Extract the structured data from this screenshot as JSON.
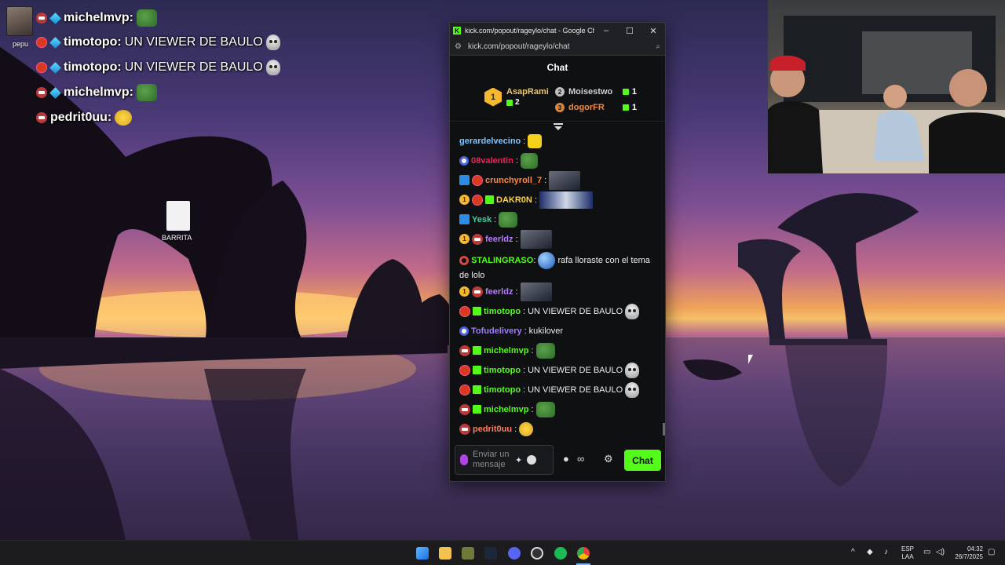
{
  "overlay": {
    "streamer_name": "pepu",
    "messages": [
      {
        "user": "michelmvp:",
        "text": ""
      },
      {
        "user": "timotopo:",
        "text": "UN VIEWER DE BAULO"
      },
      {
        "user": "timotopo:",
        "text": "UN VIEWER DE BAULO"
      },
      {
        "user": "michelmvp:",
        "text": ""
      },
      {
        "user": "pedrit0uu:",
        "text": ""
      }
    ]
  },
  "desktop": {
    "file_label": "BARRITA"
  },
  "browser": {
    "title": "kick.com/popout/rageylo/chat - Google Chro...",
    "url": "kick.com/popout/rageylo/chat",
    "minimize": "–",
    "maximize": "☐",
    "close": "✕"
  },
  "chat": {
    "header": "Chat",
    "leaderboard": {
      "first": {
        "rank": "1",
        "name": "AsapRami",
        "count": "2"
      },
      "second": {
        "rank": "2",
        "name": "Moisestwo",
        "count": "1"
      },
      "third": {
        "rank": "3",
        "name": "dogorFR",
        "count": "1"
      }
    },
    "messages": [
      {
        "user": "gerardelvecino",
        "color": "#7fc4ff",
        "text": ""
      },
      {
        "user": "08valentin",
        "color": "#e8245a",
        "text": ""
      },
      {
        "user": "crunchyroll_7",
        "color": "#ff8a3d",
        "text": ""
      },
      {
        "user": "DAKR0N",
        "color": "#ffd23a",
        "text": ""
      },
      {
        "user": "Yesk",
        "color": "#3fd0a0",
        "text": ""
      },
      {
        "user": "feerldz",
        "color": "#b57cff",
        "text": ""
      },
      {
        "user": "STALINGRASO",
        "color": "#53fc18",
        "text": "rafa lloraste con el tema de lolo"
      },
      {
        "user": "feerldz",
        "color": "#b57cff",
        "text": ""
      },
      {
        "user": "timotopo",
        "color": "#53fc18",
        "text": "UN VIEWER DE BAULO"
      },
      {
        "user": "Tofudelivery",
        "color": "#a07cff",
        "text": "kukilover"
      },
      {
        "user": "michelmvp",
        "color": "#53fc18",
        "text": ""
      },
      {
        "user": "timotopo",
        "color": "#53fc18",
        "text": "UN VIEWER DE BAULO"
      },
      {
        "user": "timotopo",
        "color": "#53fc18",
        "text": "UN VIEWER DE BAULO"
      },
      {
        "user": "michelmvp",
        "color": "#53fc18",
        "text": ""
      },
      {
        "user": "pedrit0uu",
        "color": "#ff7c5c",
        "text": ""
      }
    ],
    "input_placeholder": "Enviar un mensaje",
    "send_label": "Chat"
  },
  "taskbar": {
    "language_line1": "ESP",
    "language_line2": "LAA",
    "time": "04:32",
    "date": "26/7/2025"
  },
  "colors": {
    "kick_green": "#53fc18",
    "chat_bg": "#0f1012",
    "taskbar_bg": "#1c1c1f"
  }
}
